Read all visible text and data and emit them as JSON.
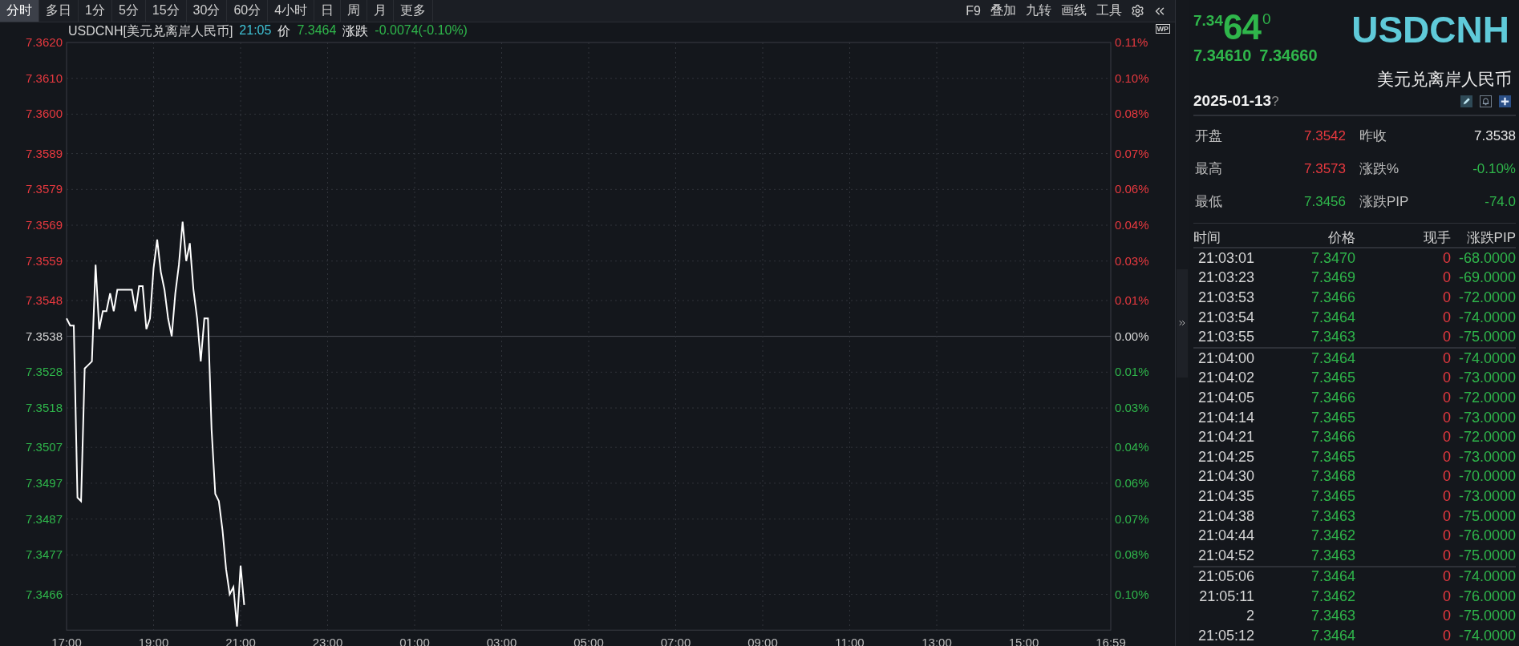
{
  "toolbar": {
    "tabs": [
      {
        "label": "分时",
        "selected": true
      },
      {
        "label": "多日",
        "selected": false
      },
      {
        "label": "1分",
        "selected": false
      },
      {
        "label": "5分",
        "selected": false
      },
      {
        "label": "15分",
        "selected": false
      },
      {
        "label": "30分",
        "selected": false
      },
      {
        "label": "60分",
        "selected": false
      },
      {
        "label": "4小时",
        "selected": false
      },
      {
        "label": "日",
        "selected": false
      },
      {
        "label": "周",
        "selected": false
      },
      {
        "label": "月",
        "selected": false
      },
      {
        "label": "更多",
        "selected": false
      }
    ],
    "tools": [
      "F9",
      "叠加",
      "九转",
      "画线",
      "工具"
    ]
  },
  "chart": {
    "info": {
      "symbol": "USDCNH[美元兑离岸人民币]",
      "time": "21:05",
      "price_label": "价",
      "price": "7.3464",
      "change_label": "涨跌",
      "change": "-0.0074(-0.10%)",
      "color": "#2fb64b"
    },
    "badge": "WP",
    "percent_ticks": [
      {
        "label": "0.11%",
        "color": "#e8393f"
      },
      {
        "label": "0.10%",
        "color": "#e8393f"
      },
      {
        "label": "0.08%",
        "color": "#e8393f"
      },
      {
        "label": "0.07%",
        "color": "#e8393f"
      },
      {
        "label": "0.06%",
        "color": "#e8393f"
      },
      {
        "label": "0.04%",
        "color": "#e8393f"
      },
      {
        "label": "0.03%",
        "color": "#e8393f"
      },
      {
        "label": "0.01%",
        "color": "#e8393f"
      },
      {
        "label": "0.00%",
        "color": "#d6d6d6"
      },
      {
        "label": "0.01%",
        "color": "#2fb64b"
      },
      {
        "label": "0.03%",
        "color": "#2fb64b"
      },
      {
        "label": "0.04%",
        "color": "#2fb64b"
      },
      {
        "label": "0.06%",
        "color": "#2fb64b"
      },
      {
        "label": "0.07%",
        "color": "#2fb64b"
      },
      {
        "label": "0.08%",
        "color": "#2fb64b"
      },
      {
        "label": "0.10%",
        "color": "#2fb64b"
      }
    ],
    "chart_data": {
      "type": "line",
      "grid": true,
      "categories": [
        "17:00",
        null,
        null,
        null,
        null,
        null,
        null,
        null,
        null,
        null,
        null,
        null,
        null,
        null,
        null,
        null,
        null,
        null,
        null,
        null,
        null,
        null,
        null,
        null,
        "19:00",
        null,
        null,
        null,
        null,
        null,
        null,
        null,
        null,
        null,
        null,
        null,
        null,
        null,
        null,
        null,
        null,
        null,
        null,
        null,
        null,
        null,
        null,
        null,
        "21:00",
        null,
        null,
        null,
        null,
        null,
        null,
        null,
        null,
        null,
        null,
        null,
        null,
        null,
        null,
        null,
        null,
        null,
        null,
        null,
        null,
        null,
        null,
        null,
        "23:00",
        null,
        null,
        null,
        null,
        null,
        null,
        null,
        null,
        null,
        null,
        null,
        null,
        null,
        null,
        null,
        null,
        null,
        null,
        null,
        null,
        null,
        null,
        null,
        "01:00",
        null,
        null,
        null,
        null,
        null,
        null,
        null,
        null,
        null,
        null,
        null,
        null,
        null,
        null,
        null,
        null,
        null,
        null,
        null,
        null,
        null,
        null,
        null,
        "03:00",
        null,
        null,
        null,
        null,
        null,
        null,
        null,
        null,
        null,
        null,
        null,
        null,
        null,
        null,
        null,
        null,
        null,
        null,
        null,
        null,
        null,
        null,
        null,
        "05:00",
        null,
        null,
        null,
        null,
        null,
        null,
        null,
        null,
        null,
        null,
        null,
        null,
        null,
        null,
        null,
        null,
        null,
        null,
        null,
        null,
        null,
        null,
        null,
        "07:00",
        null,
        null,
        null,
        null,
        null,
        null,
        null,
        null,
        null,
        null,
        null,
        null,
        null,
        null,
        null,
        null,
        null,
        null,
        null,
        null,
        null,
        null,
        null,
        "09:00",
        null,
        null,
        null,
        null,
        null,
        null,
        null,
        null,
        null,
        null,
        null,
        null,
        null,
        null,
        null,
        null,
        null,
        null,
        null,
        null,
        null,
        null,
        null,
        "11:00",
        null,
        null,
        null,
        null,
        null,
        null,
        null,
        null,
        null,
        null,
        null,
        null,
        null,
        null,
        null,
        null,
        null,
        null,
        null,
        null,
        null,
        null,
        null,
        "13:00",
        null,
        null,
        null,
        null,
        null,
        null,
        null,
        null,
        null,
        null,
        null,
        null,
        null,
        null,
        null,
        null,
        null,
        null,
        null,
        null,
        null,
        null,
        null,
        "15:00",
        null,
        null,
        null,
        null,
        null,
        null,
        null,
        null,
        null,
        null,
        null,
        null,
        null,
        null,
        null,
        null,
        null,
        null,
        null,
        null,
        null,
        null,
        null,
        "16:59"
      ],
      "series": [
        {
          "color": "#ffffff",
          "values": [
            7.3543,
            7.3541,
            7.3541,
            7.3493,
            7.3492,
            7.3529,
            7.353,
            7.3531,
            7.3558,
            7.354,
            7.3545,
            7.3545,
            7.355,
            7.3545,
            7.3551,
            7.3551,
            7.3551,
            7.3551,
            7.3551,
            7.3545,
            7.3552,
            7.3552,
            7.354,
            7.3543,
            7.3557,
            7.3565,
            7.3556,
            7.3551,
            7.3543,
            7.3538,
            7.355,
            7.3558,
            7.357,
            7.3559,
            7.3564,
            7.3551,
            7.3543,
            7.3531,
            7.3543,
            7.3543,
            7.3512,
            7.3494,
            7.3492,
            7.3484,
            7.3473,
            7.3466,
            7.3468,
            7.3457,
            7.3474,
            7.3463,
            null,
            null,
            null,
            null,
            null,
            null,
            null,
            null,
            null,
            null,
            null,
            null,
            null,
            null,
            null,
            null,
            null,
            null,
            null,
            null,
            null,
            null,
            null,
            null,
            null,
            null,
            null,
            null,
            null,
            null,
            null,
            null,
            null,
            null,
            null,
            null,
            null,
            null,
            null,
            null,
            null,
            null,
            null,
            null,
            null,
            null,
            null,
            null,
            null,
            null,
            null,
            null,
            null,
            null,
            null,
            null,
            null,
            null,
            null,
            null,
            null,
            null,
            null,
            null,
            null,
            null,
            null,
            null,
            null,
            null,
            null,
            null,
            null,
            null,
            null,
            null,
            null,
            null,
            null,
            null,
            null,
            null,
            null,
            null,
            null,
            null,
            null,
            null,
            null,
            null,
            null,
            null,
            null,
            null,
            null,
            null,
            null,
            null,
            null,
            null,
            null,
            null,
            null,
            null,
            null,
            null,
            null,
            null,
            null,
            null,
            null,
            null,
            null,
            null,
            null,
            null,
            null,
            null,
            null,
            null,
            null,
            null,
            null,
            null,
            null,
            null,
            null,
            null,
            null,
            null,
            null,
            null,
            null,
            null,
            null,
            null,
            null,
            null,
            null,
            null,
            null,
            null,
            null,
            null,
            null,
            null,
            null,
            null,
            null,
            null,
            null,
            null,
            null,
            null,
            null,
            null,
            null,
            null,
            null,
            null,
            null,
            null,
            null,
            null,
            null,
            null,
            null,
            null,
            null,
            null,
            null,
            null,
            null,
            null,
            null,
            null,
            null,
            null,
            null,
            null,
            null,
            null,
            null,
            null,
            null,
            null,
            null,
            null,
            null,
            null,
            null,
            null,
            null,
            null,
            null,
            null,
            null,
            null,
            null,
            null,
            null,
            null,
            null,
            null,
            null,
            null,
            null,
            null,
            null,
            null,
            null,
            null,
            null,
            null,
            null,
            null,
            null,
            null,
            null,
            null,
            null,
            null,
            null,
            null,
            null,
            null,
            null,
            null,
            null,
            null,
            null,
            null,
            null,
            null,
            null,
            null,
            null,
            null,
            null
          ]
        }
      ],
      "ylim": [
        7.3456,
        7.362
      ],
      "ref_lines": [
        {
          "axis": "y",
          "value": 7.3538
        }
      ],
      "yticks": [
        {
          "value": 7.362,
          "label": "7.3620"
        },
        {
          "value": 7.361,
          "label": "7.3610"
        },
        {
          "value": 7.36,
          "label": "7.3600"
        },
        {
          "value": 7.3589,
          "label": "7.3589"
        },
        {
          "value": 7.3579,
          "label": "7.3579"
        },
        {
          "value": 7.3569,
          "label": "7.3569"
        },
        {
          "value": 7.3559,
          "label": "7.3559"
        },
        {
          "value": 7.3548,
          "label": "7.3548"
        },
        {
          "value": 7.3538,
          "label": "7.3538"
        },
        {
          "value": 7.3528,
          "label": "7.3528"
        },
        {
          "value": 7.3518,
          "label": "7.3518"
        },
        {
          "value": 7.3507,
          "label": "7.3507"
        },
        {
          "value": 7.3497,
          "label": "7.3497"
        },
        {
          "value": 7.3487,
          "label": "7.3487"
        },
        {
          "value": 7.3477,
          "label": "7.3477"
        },
        {
          "value": 7.3466,
          "label": "7.3466"
        }
      ]
    }
  },
  "quote": {
    "price_small": "7.34",
    "price_big": "64",
    "price_sup": "0",
    "bid": "7.34610",
    "ask": "7.34660",
    "color": "#2fb64b",
    "symbol": "USDCNH",
    "name": "美元兑离岸人民币",
    "date": "2025-01-13",
    "date_mark": "?"
  },
  "stats": [
    [
      {
        "label": "开盘",
        "value": "7.3542",
        "color": "#e8393f"
      },
      {
        "label": "昨收",
        "value": "7.3538",
        "color": "#e6e6e6"
      }
    ],
    [
      {
        "label": "最高",
        "value": "7.3573",
        "color": "#e8393f"
      },
      {
        "label": "涨跌%",
        "value": "-0.10%",
        "color": "#2fb64b"
      }
    ],
    [
      {
        "label": "最低",
        "value": "7.3456",
        "color": "#2fb64b"
      },
      {
        "label": "涨跌PIP",
        "value": "-74.0",
        "color": "#2fb64b"
      }
    ]
  ],
  "trades": {
    "columns": [
      "时间",
      "价格",
      "现手",
      "涨跌PIP"
    ],
    "groups": [
      {
        "rows": [
          {
            "time": "21:03:01",
            "price": "7.3470",
            "volume": "0",
            "pip": "-68.0000"
          },
          {
            "time": "21:03:23",
            "price": "7.3469",
            "volume": "0",
            "pip": "-69.0000"
          },
          {
            "time": "21:03:53",
            "price": "7.3466",
            "volume": "0",
            "pip": "-72.0000"
          },
          {
            "time": "21:03:54",
            "price": "7.3464",
            "volume": "0",
            "pip": "-74.0000"
          },
          {
            "time": "21:03:55",
            "price": "7.3463",
            "volume": "0",
            "pip": "-75.0000"
          }
        ]
      },
      {
        "rows": [
          {
            "time": "21:04:00",
            "price": "7.3464",
            "volume": "0",
            "pip": "-74.0000"
          },
          {
            "time": "21:04:02",
            "price": "7.3465",
            "volume": "0",
            "pip": "-73.0000"
          },
          {
            "time": "21:04:05",
            "price": "7.3466",
            "volume": "0",
            "pip": "-72.0000"
          },
          {
            "time": "21:04:14",
            "price": "7.3465",
            "volume": "0",
            "pip": "-73.0000"
          },
          {
            "time": "21:04:21",
            "price": "7.3466",
            "volume": "0",
            "pip": "-72.0000"
          },
          {
            "time": "21:04:25",
            "price": "7.3465",
            "volume": "0",
            "pip": "-73.0000"
          },
          {
            "time": "21:04:30",
            "price": "7.3468",
            "volume": "0",
            "pip": "-70.0000"
          },
          {
            "time": "21:04:35",
            "price": "7.3465",
            "volume": "0",
            "pip": "-73.0000"
          },
          {
            "time": "21:04:38",
            "price": "7.3463",
            "volume": "0",
            "pip": "-75.0000"
          },
          {
            "time": "21:04:44",
            "price": "7.3462",
            "volume": "0",
            "pip": "-76.0000"
          },
          {
            "time": "21:04:52",
            "price": "7.3463",
            "volume": "0",
            "pip": "-75.0000"
          }
        ]
      },
      {
        "rows": [
          {
            "time": "21:05:06",
            "price": "7.3464",
            "volume": "0",
            "pip": "-74.0000"
          },
          {
            "time": "21:05:11",
            "price": "7.3462",
            "volume": "0",
            "pip": "-76.0000"
          },
          {
            "time": "2",
            "price": "7.3463",
            "volume": "0",
            "pip": "-75.0000"
          },
          {
            "time": "21:05:12",
            "price": "7.3464",
            "volume": "0",
            "pip": "-74.0000"
          }
        ]
      }
    ]
  }
}
